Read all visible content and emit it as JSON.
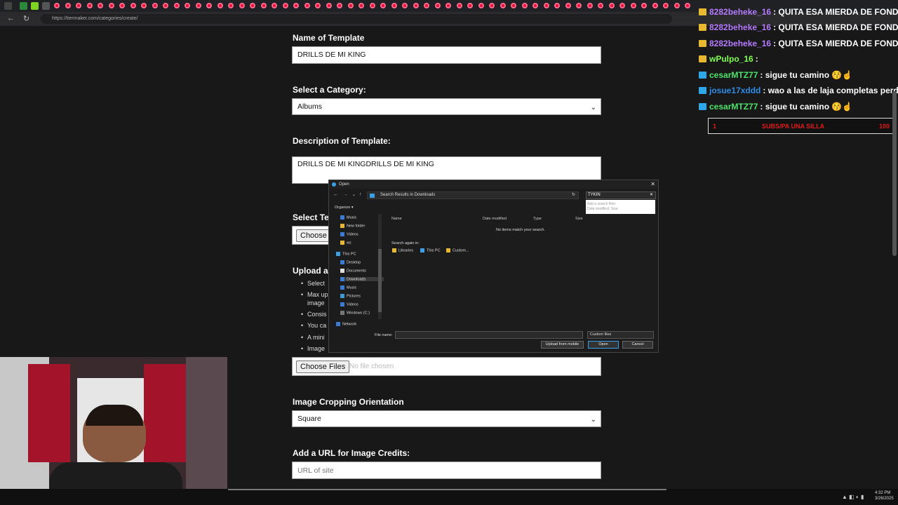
{
  "browser": {
    "url": "https://tiermaker.com/categories/create/"
  },
  "form": {
    "name_label": "Name of Template",
    "name_value": "DRILLS DE MI KING",
    "category_label": "Select a Category:",
    "category_value": "Albums",
    "description_label": "Description of Template:",
    "description_value": "DRILLS DE MI KINGDRILLS DE MI KING",
    "select_template_label": "Select Tem",
    "choose_button": "Choose",
    "upload_label": "Upload a S",
    "bullets": [
      "Select",
      "Max up",
      "image",
      "Consis",
      "You ca",
      "A mini",
      "Image"
    ],
    "choose_files_button": "Choose Files",
    "no_file_text": "No file chosen",
    "cropping_label": "Image Cropping Orientation",
    "cropping_value": "Square",
    "credits_label": "Add a URL for Image Credits:",
    "credits_placeholder": "URL of site"
  },
  "dialog": {
    "title": "Open",
    "path": "Search Results in Downloads",
    "search_value": "TYKIN",
    "suggestion_title": "Add a search filter",
    "suggestion_filters": "Date modified:   Size:",
    "organize": "Organize",
    "tree": [
      "Music",
      "New folder",
      "Videos",
      "wz",
      "This PC",
      "Desktop",
      "Documents",
      "Downloads",
      "Music",
      "Pictures",
      "Videos",
      "Windows (C:)",
      "Network"
    ],
    "columns": [
      "Name",
      "Date modified",
      "Type",
      "Size"
    ],
    "empty_message": "No items match your search.",
    "search_again": "Search again in:",
    "search_locations": [
      "Libraries",
      "This PC",
      "Custom..."
    ],
    "filename_label": "File name:",
    "filetype": "Custom files",
    "btn_upload_mobile": "Upload from mobile",
    "btn_open": "Open",
    "btn_cancel": "Cancel"
  },
  "chat": [
    {
      "user": "8282beheke_16",
      "message": ": QUITA ESA MIERDA DE FONDO",
      "color": "#b57bff"
    },
    {
      "user": "8282beheke_16",
      "message": ": QUITA ESA MIERDA DE FONDO",
      "color": "#b57bff"
    },
    {
      "user": "8282beheke_16",
      "message": ": QUITA ESA MIERDA DE FONDO",
      "color": "#b57bff"
    },
    {
      "user": "wPulpo_16",
      "message": ":",
      "color": "#7fff4f"
    },
    {
      "user": "cesarMTZ77",
      "message": ": sigue tu camino 😚☝",
      "color": "#4ce36b"
    },
    {
      "user": "josue17xddd",
      "message": ": wao a las de laja completas perd",
      "color": "#2e8ce8"
    },
    {
      "user": "cesarMTZ77",
      "message": ": sigue tu camino 😚☝",
      "color": "#4ce36b"
    }
  ],
  "goal": {
    "current": "1",
    "label": "SUBS/PA UNA SILLA",
    "target": "100"
  },
  "taskbar": {
    "time": "4:32 PM",
    "date": "3/26/2025"
  }
}
